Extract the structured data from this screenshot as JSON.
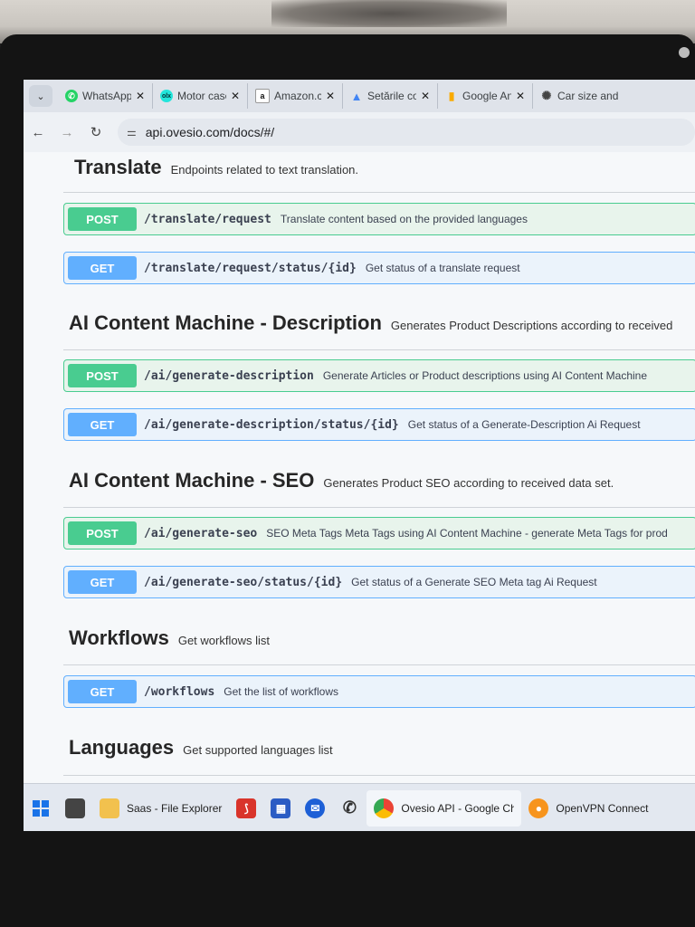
{
  "browser": {
    "tabs": [
      {
        "label": "WhatsApp",
        "icon": "whatsapp-icon",
        "color": "#25d366"
      },
      {
        "label": "Motor case",
        "icon": "olx-icon",
        "color": "#23e5db"
      },
      {
        "label": "Amazon.com",
        "icon": "amazon-icon",
        "color": "#232f3e"
      },
      {
        "label": "Setările con",
        "icon": "google-ads-icon",
        "color": "#4285f4"
      },
      {
        "label": "Google An",
        "icon": "google-analytics-icon",
        "color": "#f9ab00"
      },
      {
        "label": "Car size and",
        "icon": "chatgpt-icon",
        "color": "#555555"
      }
    ],
    "url": "api.ovesio.com/docs/#/"
  },
  "sections": [
    {
      "title": "Translate",
      "description": "Endpoints related to text translation.",
      "operations": [
        {
          "method": "POST",
          "path": "/translate/request",
          "summary": "Translate content based on the provided languages"
        },
        {
          "method": "GET",
          "path": "/translate/request/status/{id}",
          "summary": "Get status of a translate request"
        }
      ]
    },
    {
      "title": "AI Content Machine - Description",
      "description": "Generates Product Descriptions according to received",
      "operations": [
        {
          "method": "POST",
          "path": "/ai/generate-description",
          "summary": "Generate Articles or Product descriptions using AI Content Machine"
        },
        {
          "method": "GET",
          "path": "/ai/generate-description/status/{id}",
          "summary": "Get status of a Generate-Description Ai Request"
        }
      ]
    },
    {
      "title": "AI Content Machine - SEO",
      "description": "Generates Product SEO according to received data set.",
      "operations": [
        {
          "method": "POST",
          "path": "/ai/generate-seo",
          "summary": "SEO Meta Tags Meta Tags using AI Content Machine - generate Meta Tags for prod"
        },
        {
          "method": "GET",
          "path": "/ai/generate-seo/status/{id}",
          "summary": "Get status of a Generate SEO Meta tag Ai Request"
        }
      ]
    },
    {
      "title": "Workflows",
      "description": "Get workflows list",
      "operations": [
        {
          "method": "GET",
          "path": "/workflows",
          "summary": "Get the list of workflows"
        }
      ]
    },
    {
      "title": "Languages",
      "description": "Get supported languages list"
    }
  ],
  "taskbar": {
    "explorer_label": "Saas - File Explorer",
    "chrome_label": "Ovesio API - Google Chrome",
    "openvpn_label": "OpenVPN Connect"
  },
  "colors": {
    "post": "#49cc90",
    "get": "#61affe"
  }
}
